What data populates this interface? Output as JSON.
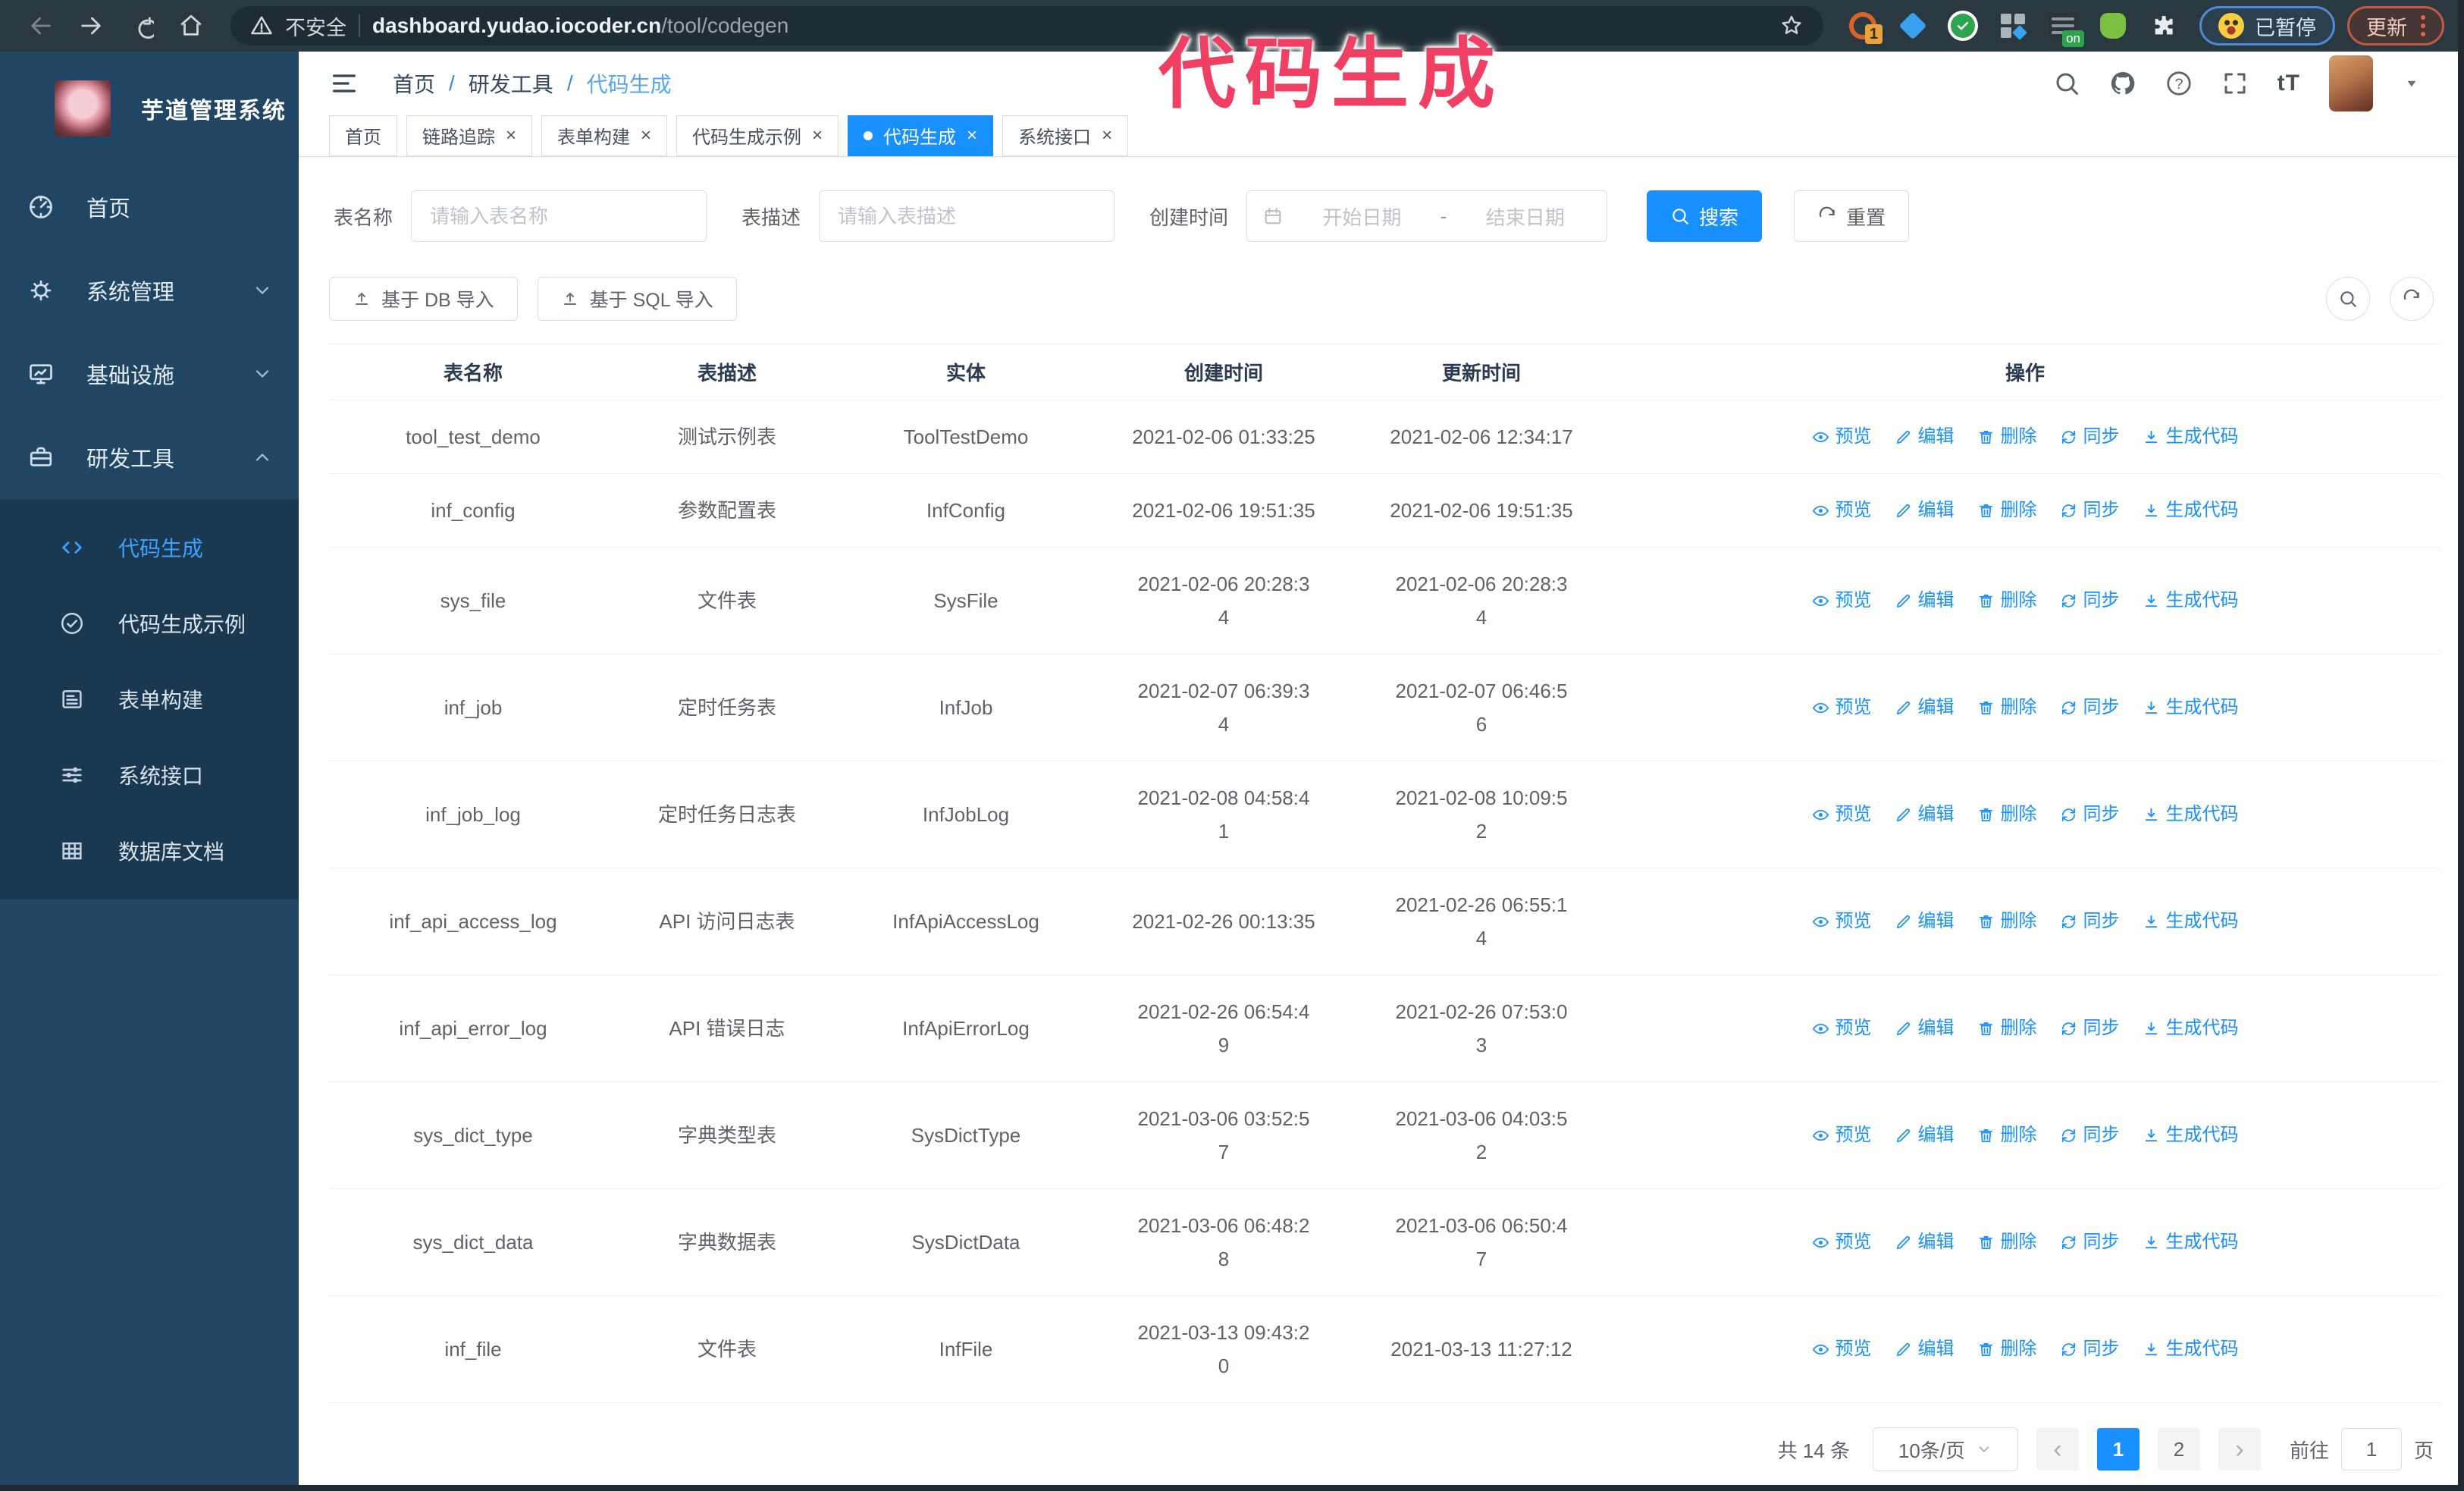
{
  "browser": {
    "security_label": "不安全",
    "url_host": "dashboard.yudao.iocoder.cn",
    "url_path": "/tool/codegen",
    "ext_badge": "1",
    "ext_on_label": "on",
    "paused_badge": "已暂停",
    "update_button": "更新"
  },
  "overlay": {
    "title": "代码生成",
    "color": "#ef3f63"
  },
  "sidebar": {
    "app_title": "芋道管理系统",
    "items": [
      {
        "id": "home",
        "label": "首页",
        "icon": "i-dash",
        "expandable": false,
        "expanded": false
      },
      {
        "id": "system",
        "label": "系统管理",
        "icon": "i-gear",
        "expandable": true,
        "expanded": false
      },
      {
        "id": "infra",
        "label": "基础设施",
        "icon": "i-monitor",
        "expandable": true,
        "expanded": false
      },
      {
        "id": "devtools",
        "label": "研发工具",
        "icon": "i-brief",
        "expandable": true,
        "expanded": true
      }
    ],
    "submenu": [
      {
        "id": "codegen",
        "label": "代码生成",
        "icon": "i-code",
        "active": true
      },
      {
        "id": "codegen-example",
        "label": "代码生成示例",
        "icon": "i-check",
        "active": false
      },
      {
        "id": "form-builder",
        "label": "表单构建",
        "icon": "i-form",
        "active": false
      },
      {
        "id": "system-api",
        "label": "系统接口",
        "icon": "i-sliders",
        "active": false
      },
      {
        "id": "db-doc",
        "label": "数据库文档",
        "icon": "i-grid",
        "active": false
      }
    ]
  },
  "header": {
    "breadcrumb": [
      "首页",
      "研发工具",
      "代码生成"
    ],
    "breadcrumb_separator": "/",
    "font_size_icon_label": "tT"
  },
  "tabs_meta": {
    "close_glyph": "×"
  },
  "tabs": [
    {
      "label": "首页",
      "closable": false,
      "active": false
    },
    {
      "label": "链路追踪",
      "closable": true,
      "active": false
    },
    {
      "label": "表单构建",
      "closable": true,
      "active": false
    },
    {
      "label": "代码生成示例",
      "closable": true,
      "active": false
    },
    {
      "label": "代码生成",
      "closable": true,
      "active": true
    },
    {
      "label": "系统接口",
      "closable": true,
      "active": false
    }
  ],
  "filters": {
    "table_name_label": "表名称",
    "table_name_placeholder": "请输入表名称",
    "table_desc_label": "表描述",
    "table_desc_placeholder": "请输入表描述",
    "create_time_label": "创建时间",
    "date_start_placeholder": "开始日期",
    "date_separator": "-",
    "date_end_placeholder": "结束日期",
    "search_button": "搜索",
    "reset_button": "重置"
  },
  "toolbar": {
    "import_db_button": "基于 DB 导入",
    "import_sql_button": "基于 SQL 导入"
  },
  "table": {
    "columns": [
      "表名称",
      "表描述",
      "实体",
      "创建时间",
      "更新时间",
      "操作"
    ],
    "action_labels": [
      "预览",
      "编辑",
      "删除",
      "同步",
      "生成代码"
    ],
    "rows": [
      {
        "name": "tool_test_demo",
        "desc": "测试示例表",
        "entity": "ToolTestDemo",
        "created": "2021-02-06 01:33:25",
        "updated": "2021-02-06 12:34:17"
      },
      {
        "name": "inf_config",
        "desc": "参数配置表",
        "entity": "InfConfig",
        "created": "2021-02-06 19:51:35",
        "updated": "2021-02-06 19:51:35"
      },
      {
        "name": "sys_file",
        "desc": "文件表",
        "entity": "SysFile",
        "created": "2021-02-06 20:28:3\n4",
        "updated": "2021-02-06 20:28:3\n4"
      },
      {
        "name": "inf_job",
        "desc": "定时任务表",
        "entity": "InfJob",
        "created": "2021-02-07 06:39:3\n4",
        "updated": "2021-02-07 06:46:5\n6"
      },
      {
        "name": "inf_job_log",
        "desc": "定时任务日志表",
        "entity": "InfJobLog",
        "created": "2021-02-08 04:58:4\n1",
        "updated": "2021-02-08 10:09:5\n2"
      },
      {
        "name": "inf_api_access_log",
        "desc": "API 访问日志表",
        "entity": "InfApiAccessLog",
        "created": "2021-02-26 00:13:35",
        "updated": "2021-02-26 06:55:1\n4"
      },
      {
        "name": "inf_api_error_log",
        "desc": "API 错误日志",
        "entity": "InfApiErrorLog",
        "created": "2021-02-26 06:54:4\n9",
        "updated": "2021-02-26 07:53:0\n3"
      },
      {
        "name": "sys_dict_type",
        "desc": "字典类型表",
        "entity": "SysDictType",
        "created": "2021-03-06 03:52:5\n7",
        "updated": "2021-03-06 04:03:5\n2"
      },
      {
        "name": "sys_dict_data",
        "desc": "字典数据表",
        "entity": "SysDictData",
        "created": "2021-03-06 06:48:2\n8",
        "updated": "2021-03-06 06:50:4\n7"
      },
      {
        "name": "inf_file",
        "desc": "文件表",
        "entity": "InfFile",
        "created": "2021-03-13 09:43:2\n0",
        "updated": "2021-03-13 11:27:12"
      }
    ]
  },
  "pagination": {
    "total": "共 14 条",
    "page_size": "10条/页",
    "prev_glyph": "‹",
    "next_glyph": "›",
    "pages": [
      "1",
      "2"
    ],
    "active_page": "1",
    "goto_label": "前往",
    "goto_value": "1",
    "page_suffix": "页"
  }
}
